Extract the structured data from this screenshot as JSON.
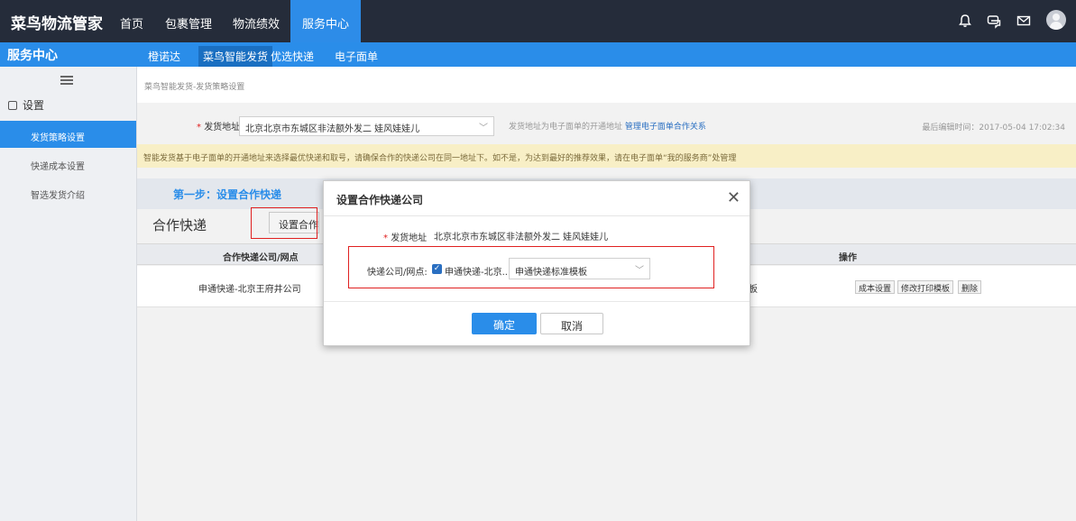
{
  "topnav": {
    "brand": "菜鸟物流管家",
    "items": [
      {
        "label": "首页"
      },
      {
        "label": "包裹管理"
      },
      {
        "label": "物流绩效"
      },
      {
        "label": "服务中心"
      }
    ],
    "icons": [
      "bell-icon",
      "chat-icon",
      "mail-icon",
      "user-avatar"
    ]
  },
  "subnav": {
    "title": "服务中心",
    "items": [
      {
        "label": "橙诺达"
      },
      {
        "label": "菜鸟智能发货"
      },
      {
        "label": "优选快递"
      },
      {
        "label": "电子面单"
      }
    ]
  },
  "sidebar": {
    "section": "设置",
    "items": [
      {
        "label": "发货策略设置"
      },
      {
        "label": "快递成本设置"
      },
      {
        "label": "智选发货介绍"
      }
    ]
  },
  "main": {
    "breadcrumb": "菜鸟智能发货-发货策略设置",
    "address_label": "发货地址",
    "address_value": "北京北京市东城区非法额外发二 娃风娃娃儿",
    "address_hint": "发货地址为电子面单的开通地址",
    "address_link": "管理电子面单合作关系",
    "last_edit": "最后编辑时间：2017-05-04 17:02:34",
    "notice": "智能发货基于电子面单的开通地址来选择最优快递和取号，请确保合作的快递公司在同一地址下。如不是，为达到最好的推荐效果，请在电子面单“我的服务商”处管理",
    "step_title": "第一步：设置合作快递",
    "partner_label": "合作快递",
    "partner_button": "设置合作快递",
    "table": {
      "headers": [
        "合作快递公司/网点",
        "操作"
      ],
      "rows": [
        {
          "company": "申通快递-北京王府井公司",
          "clipped_text": "板",
          "actions": [
            "成本设置",
            "修改打印模板",
            "删除"
          ]
        }
      ]
    }
  },
  "dialog": {
    "title": "设置合作快递公司",
    "address_label": "发货地址",
    "address_value": "北京北京市东城区非法额外发二 娃风娃娃儿",
    "courier_label": "快递公司/网点:",
    "courier_checked": true,
    "courier_value": "申通快递-北京...",
    "template_value": "申通快递标准模板",
    "ok_label": "确定",
    "cancel_label": "取消"
  },
  "colors": {
    "topnav_bg": "#252c3a",
    "accent": "#2a8de9",
    "notice_bg": "#f8efc6",
    "highlight_border": "#e02020"
  }
}
